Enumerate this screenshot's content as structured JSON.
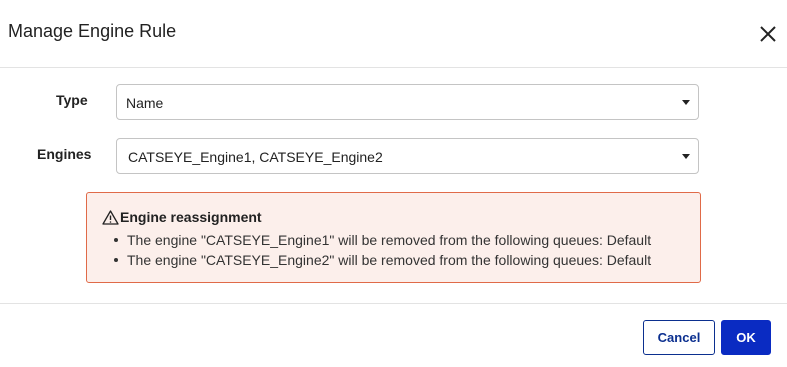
{
  "dialog": {
    "title": "Manage Engine Rule",
    "close_icon": "close-icon"
  },
  "form": {
    "type_label": "Type",
    "type_value": "Name",
    "engines_label": "Engines",
    "engines_value": "CATSEYE_Engine1,  CATSEYE_Engine2"
  },
  "warning": {
    "icon": "warning-triangle-icon",
    "title": "Engine reassignment",
    "items": [
      "The engine \"CATSEYE_Engine1\" will be removed from the following queues: Default",
      "The engine \"CATSEYE_Engine2\" will be removed from the following queues: Default"
    ],
    "colors": {
      "background": "#fcefeb",
      "border": "#e06a48"
    }
  },
  "footer": {
    "cancel_label": "Cancel",
    "ok_label": "OK",
    "colors": {
      "primary": "#0a2bc2",
      "secondary_text": "#0b2f8f"
    }
  }
}
